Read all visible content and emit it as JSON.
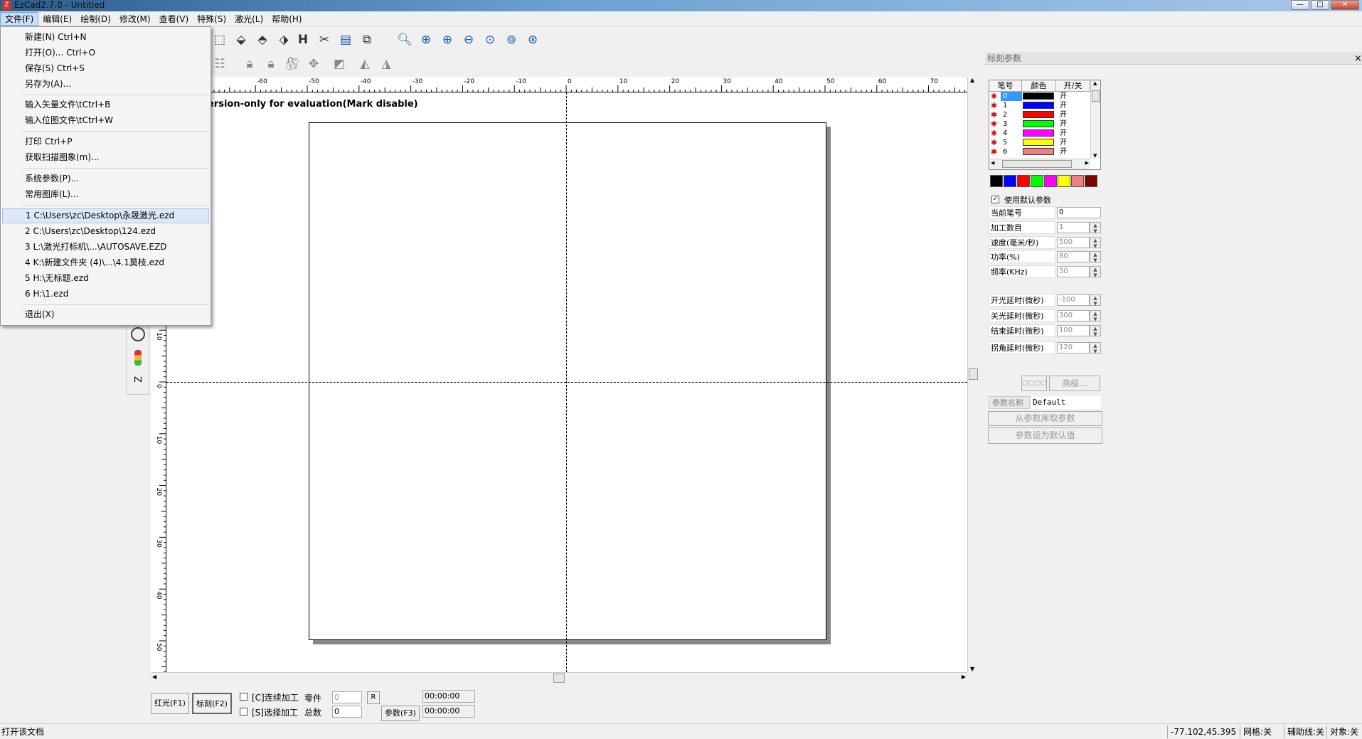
{
  "window": {
    "title": "EzCad2.7.0 - Untitled",
    "min": "—",
    "max": "□",
    "close": "✕"
  },
  "menu": [
    "文件(F)",
    "编辑(E)",
    "绘制(D)",
    "修改(M)",
    "查看(V)",
    "特殊(S)",
    "激光(L)",
    "帮助(H)"
  ],
  "file_menu": {
    "items": [
      "新建(N) Ctrl+N",
      "打开(O)... Ctrl+O",
      "保存(S) Ctrl+S",
      "另存为(A)...",
      "输入矢量文件\\tCtrl+B",
      "输入位图文件\\tCtrl+W",
      "打印 Ctrl+P",
      "获取扫描图象(m)...",
      "系统参数(P)...",
      "常用图库(L)...",
      "1 C:\\Users\\zc\\Desktop\\永晟激光.ezd",
      "2 C:\\Users\\zc\\Desktop\\124.ezd",
      "3 L:\\激光打标机\\...\\AUTOSAVE.EZD",
      "4 K:\\新建文件夹 (4)\\...\\4.1莫枝.ezd",
      "5 H:\\无标题.ezd",
      "6 H:\\1.ezd",
      "退出(X)"
    ]
  },
  "canvas": {
    "watermark": "ersion-only for evaluation(Mark disable)"
  },
  "ruler": {
    "h_ticks": [
      "-60",
      "-50",
      "-40",
      "-30",
      "-20",
      "-10",
      "0",
      "10",
      "20",
      "30",
      "40",
      "50",
      "60",
      "70"
    ],
    "v_ticks": [
      "10",
      "0",
      "10",
      "20",
      "30",
      "40",
      "50"
    ]
  },
  "right_panel": {
    "title": "标刻参数",
    "close": "×",
    "pen_headers": [
      "笔号",
      "颜色",
      "开/关"
    ],
    "pens": [
      {
        "num": "0",
        "color": "#000000",
        "state": "开"
      },
      {
        "num": "1",
        "color": "#0000ff",
        "state": "开"
      },
      {
        "num": "2",
        "color": "#ff0000",
        "state": "开"
      },
      {
        "num": "3",
        "color": "#00ff00",
        "state": "开"
      },
      {
        "num": "4",
        "color": "#ff00ff",
        "state": "开"
      },
      {
        "num": "5",
        "color": "#ffff00",
        "state": "开"
      },
      {
        "num": "6",
        "color": "#f08080",
        "state": "开"
      }
    ],
    "palette": [
      "#000000",
      "#0000ff",
      "#ff0000",
      "#00ff00",
      "#ff00ff",
      "#ffff00",
      "#f08080",
      "#800000"
    ],
    "use_default": "使用默认参数",
    "params": [
      {
        "label": "当前笔号",
        "value": "0",
        "spin": false,
        "enabled": true
      },
      {
        "label": "加工数目",
        "value": "1",
        "spin": true,
        "enabled": false
      },
      {
        "label": "速度(毫米/秒)",
        "value": "500",
        "spin": true,
        "enabled": false
      },
      {
        "label": "功率(%)",
        "value": "80",
        "spin": true,
        "enabled": false
      },
      {
        "label": "频率(KHz)",
        "value": "30",
        "spin": true,
        "enabled": false
      },
      {
        "label": "开光延时(微秒)",
        "value": "-100",
        "spin": true,
        "enabled": false
      },
      {
        "label": "关光延时(微秒)",
        "value": "300",
        "spin": true,
        "enabled": false
      },
      {
        "label": "结束延时(微秒)",
        "value": "100",
        "spin": true,
        "enabled": false
      },
      {
        "label": "拐角延时(微秒)",
        "value": "120",
        "spin": true,
        "enabled": false
      }
    ],
    "btn_pattern": "○○○○",
    "btn_advanced": "高级...",
    "param_name_label": "参数名称",
    "param_name_value": "Default",
    "btn_from_lib": "从参数库取参数",
    "btn_set_default": "参数设为默认值"
  },
  "bottom": {
    "red_light": "红光(F1)",
    "mark": "标刻(F2)",
    "continuous": "[C]连续加工",
    "select": "[S]选择加工",
    "parts_label": "零件",
    "parts_value": "0",
    "total_label": "总数",
    "total_value": "0",
    "r_btn": "R",
    "params_btn": "参数(F3)",
    "time1": "00:00:00",
    "time2": "00:00:00"
  },
  "status": {
    "left": "打开该文档",
    "coords": "-77.102,45.395",
    "grid": "网格:关",
    "guides": "辅助线:关",
    "obj": "对象:关"
  }
}
